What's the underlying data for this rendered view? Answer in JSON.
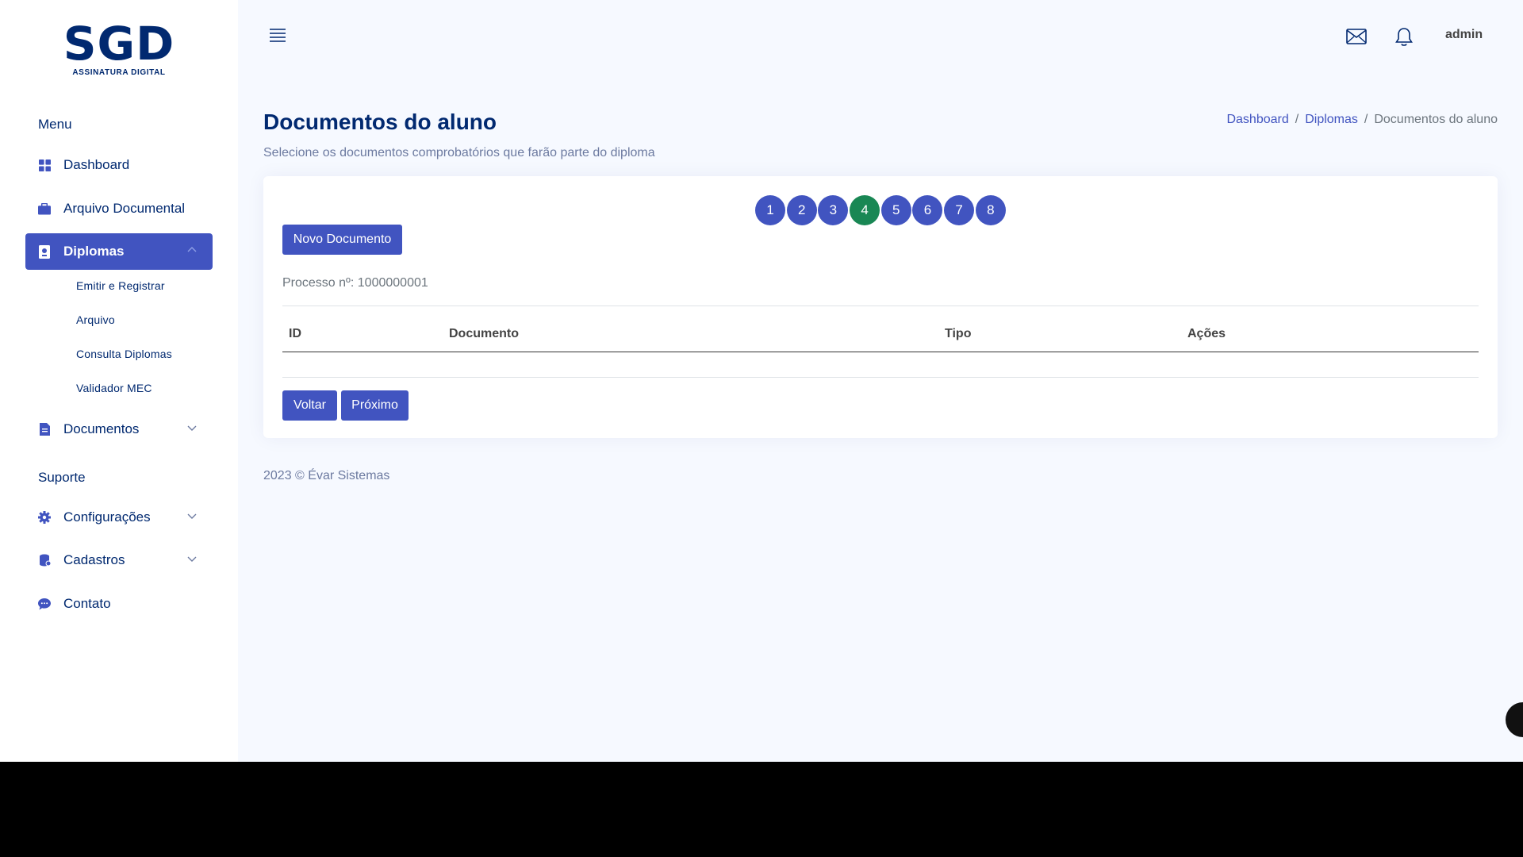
{
  "logo": {
    "main": "SGD",
    "sub": "ASSINATURA DIGITAL"
  },
  "sidebar": {
    "menu_heading": "Menu",
    "support_heading": "Suporte",
    "items": {
      "dashboard": "Dashboard",
      "arquivo_documental": "Arquivo Documental",
      "diplomas": "Diplomas",
      "documentos": "Documentos",
      "configuracoes": "Configurações",
      "cadastros": "Cadastros",
      "contato": "Contato"
    },
    "diplomas_sub": [
      "Emitir e Registrar",
      "Arquivo",
      "Consulta Diplomas",
      "Validador MEC"
    ]
  },
  "header": {
    "user": "admin"
  },
  "page": {
    "title": "Documentos do aluno",
    "subtitle": "Selecione os documentos comprobatórios que farão parte do diploma"
  },
  "breadcrumb": [
    "Dashboard",
    "Diplomas",
    "Documentos do aluno"
  ],
  "steps": {
    "labels": [
      "1",
      "2",
      "3",
      "4",
      "5",
      "6",
      "7",
      "8"
    ],
    "current": "4",
    "color_default": "#4154c0",
    "color_current": "#198754"
  },
  "card": {
    "new_button": "Novo Documento",
    "process_label": "Processo nº:",
    "process_value": "1000000001",
    "table_headers": {
      "id": "ID",
      "documento": "Documento",
      "tipo": "Tipo",
      "acoes": "Ações"
    },
    "back_button": "Voltar",
    "next_button": "Próximo"
  },
  "footer": "2023 © Évar Sistemas",
  "colors": {
    "accent": "#4154c0",
    "brand": "#012970",
    "success": "#198754"
  }
}
